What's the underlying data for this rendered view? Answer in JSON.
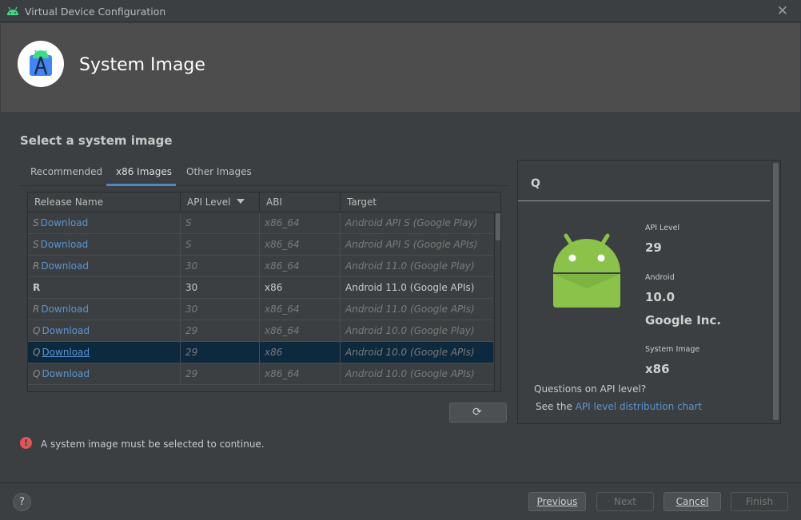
{
  "window": {
    "title": "Virtual Device Configuration",
    "close_glyph": "✕"
  },
  "header": {
    "title": "System Image"
  },
  "section": {
    "title": "Select a system image"
  },
  "tabs": [
    {
      "label": "Recommended"
    },
    {
      "label": "x86 Images",
      "selected": true
    },
    {
      "label": "Other Images"
    }
  ],
  "table": {
    "columns": [
      "Release Name",
      "API Level",
      "ABI",
      "Target"
    ],
    "sort_column": "API Level",
    "rows": [
      {
        "prefix": "S",
        "release": "Download",
        "api": "S",
        "abi": "x86_64",
        "target": "Android API S (Google Play)",
        "installed": false
      },
      {
        "prefix": "S",
        "release": "Download",
        "api": "S",
        "abi": "x86_64",
        "target": "Android API S (Google APIs)",
        "installed": false
      },
      {
        "prefix": "R",
        "release": "Download",
        "api": "30",
        "abi": "x86_64",
        "target": "Android 11.0 (Google Play)",
        "installed": false
      },
      {
        "prefix": "R",
        "release": "",
        "api": "30",
        "abi": "x86",
        "target": "Android 11.0 (Google APIs)",
        "installed": true
      },
      {
        "prefix": "R",
        "release": "Download",
        "api": "30",
        "abi": "x86_64",
        "target": "Android 11.0 (Google APIs)",
        "installed": false
      },
      {
        "prefix": "Q",
        "release": "Download",
        "api": "29",
        "abi": "x86_64",
        "target": "Android 10.0 (Google Play)",
        "installed": false
      },
      {
        "prefix": "Q",
        "release": "Download",
        "api": "29",
        "abi": "x86",
        "target": "Android 10.0 (Google APIs)",
        "installed": false,
        "selected": true
      },
      {
        "prefix": "Q",
        "release": "Download",
        "api": "29",
        "abi": "x86_64",
        "target": "Android 10.0 (Google APIs)",
        "installed": false
      }
    ]
  },
  "refresh": {
    "icon": "refresh-icon",
    "glyph": "⟳"
  },
  "error": {
    "icon": "!",
    "message": "A system image must be selected to continue."
  },
  "detail": {
    "heading": "Q",
    "api_level_label": "API Level",
    "api_level": "29",
    "android_label": "Android",
    "android_version": "10.0",
    "vendor": "Google Inc.",
    "system_image_label": "System Image",
    "system_image": "x86",
    "question": "Questions on API level?",
    "see_prefix": "See the ",
    "link_text": "API level distribution chart",
    "robot_color": "#8bc34a"
  },
  "footer": {
    "help": "?",
    "previous": "Previous",
    "next": "Next",
    "cancel": "Cancel",
    "finish": "Finish"
  },
  "colors": {
    "accent": "#4a88c7",
    "link": "#5994d2",
    "selected_row": "#0d293e",
    "error": "#e05555"
  }
}
